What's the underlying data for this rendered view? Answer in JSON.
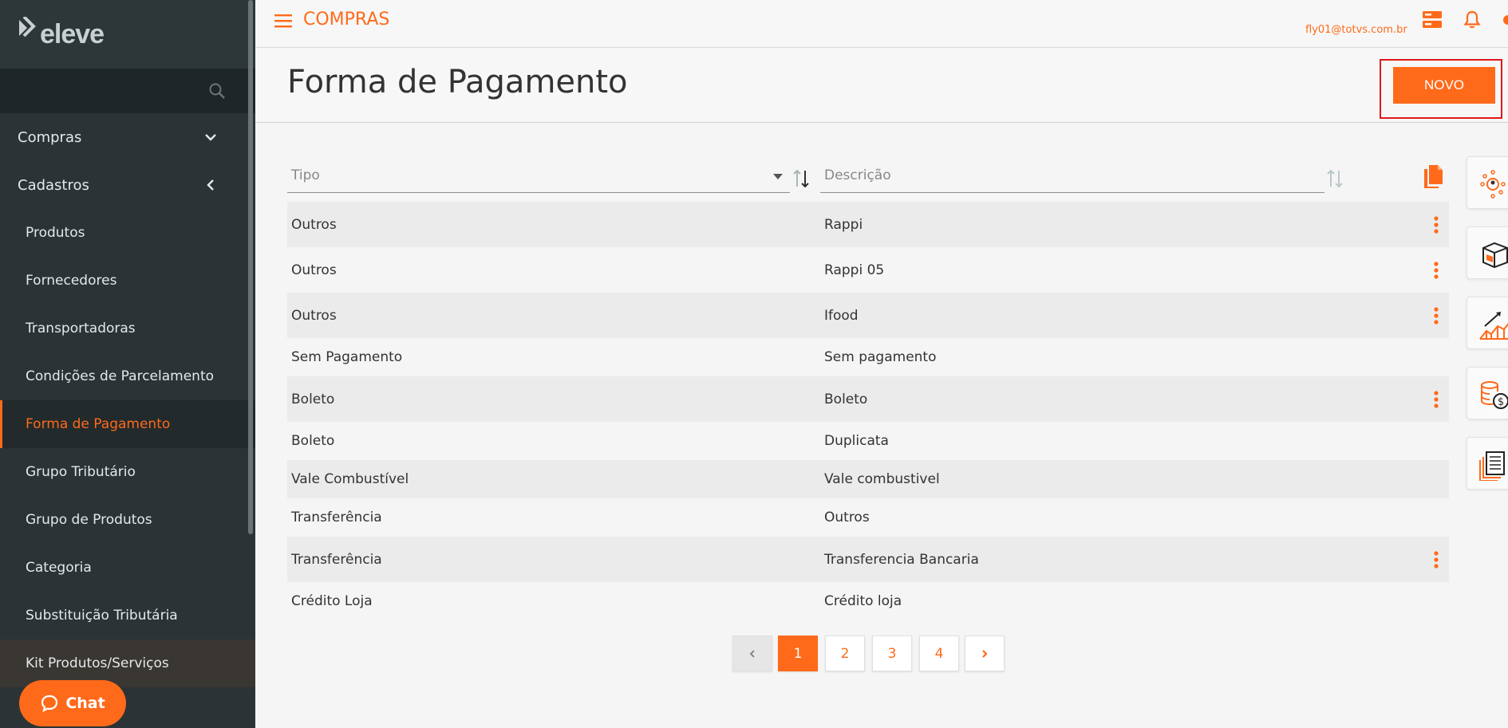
{
  "sidebar": {
    "logo": "eleve",
    "menu": [
      {
        "label": "Compras"
      },
      {
        "label": "Cadastros"
      }
    ],
    "items": [
      {
        "label": "Produtos"
      },
      {
        "label": "Fornecedores"
      },
      {
        "label": "Transportadoras"
      },
      {
        "label": "Condições de Parcelamento"
      },
      {
        "label": "Forma de Pagamento"
      },
      {
        "label": "Grupo Tributário"
      },
      {
        "label": "Grupo de Produtos"
      },
      {
        "label": "Categoria"
      },
      {
        "label": "Substituição Tributária"
      },
      {
        "label": "Kit Produtos/Serviços"
      }
    ],
    "chat_label": "Chat"
  },
  "topbar": {
    "app_title": "COMPRAS",
    "user_email": "fly01@totvs.com.br"
  },
  "header": {
    "title": "Forma de Pagamento",
    "new_button": "NOVO"
  },
  "table": {
    "filters": {
      "tipo_placeholder": "Tipo",
      "descricao_placeholder": "Descrição"
    },
    "rows": [
      {
        "tipo": "Outros",
        "descricao": "Rappi"
      },
      {
        "tipo": "Outros",
        "descricao": "Rappi 05"
      },
      {
        "tipo": "Outros",
        "descricao": "Ifood"
      },
      {
        "tipo": "Sem Pagamento",
        "descricao": "Sem pagamento"
      },
      {
        "tipo": "Boleto",
        "descricao": "Boleto"
      },
      {
        "tipo": "Boleto",
        "descricao": "Duplicata"
      },
      {
        "tipo": "Vale Combustível",
        "descricao": "Vale combustivel"
      },
      {
        "tipo": "Transferência",
        "descricao": "Outros"
      },
      {
        "tipo": "Transferência",
        "descricao": "Transferencia Bancaria"
      },
      {
        "tipo": "Crédito Loja",
        "descricao": "Crédito loja"
      }
    ]
  },
  "pagination": {
    "pages": [
      "1",
      "2",
      "3",
      "4"
    ],
    "current": "1"
  },
  "colors": {
    "accent": "#ff6a1a",
    "sidebar_bg": "#2b3336",
    "highlight_border": "#e01818"
  }
}
